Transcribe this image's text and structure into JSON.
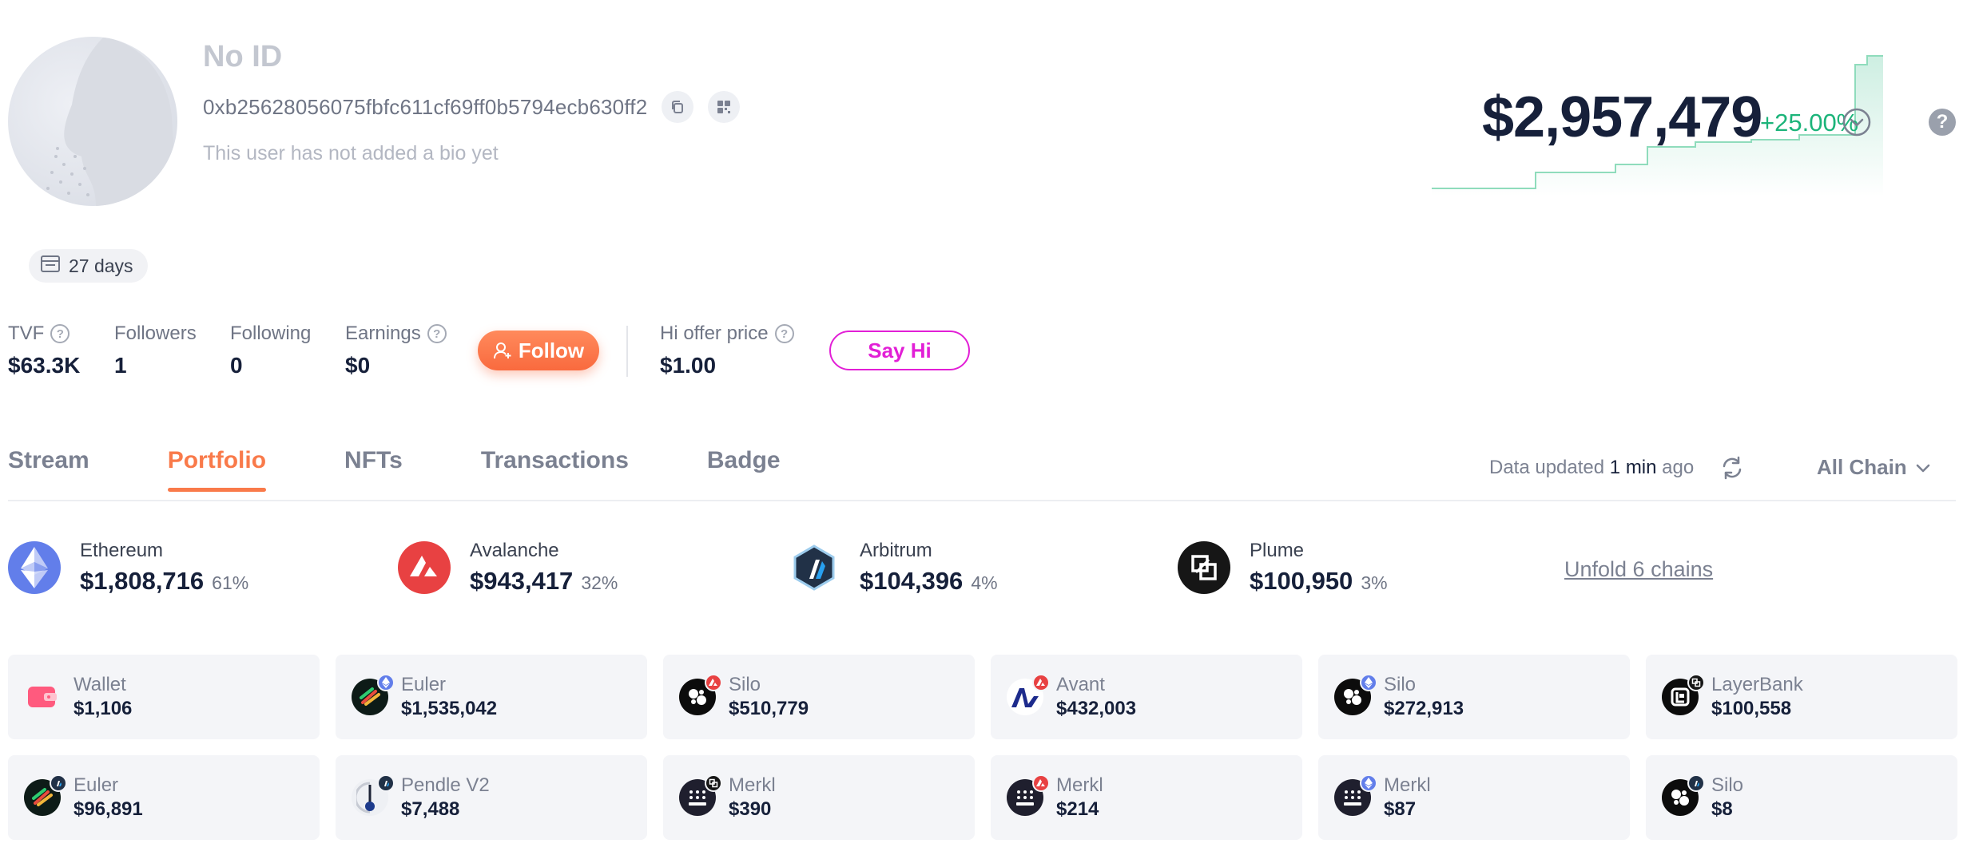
{
  "profile": {
    "name": "No ID",
    "address": "0xb25628056075fbfc611cf69ff0b5794ecb630ff2",
    "bio": "This user has not added a bio yet",
    "age_badge": "27 days"
  },
  "balance": {
    "value": "$2,957,479",
    "change": "+25.00%",
    "change_color": "#1cb47a"
  },
  "stats": {
    "tvf": {
      "label": "TVF",
      "value": "$63.3K"
    },
    "followers": {
      "label": "Followers",
      "value": "1"
    },
    "following": {
      "label": "Following",
      "value": "0"
    },
    "earnings": {
      "label": "Earnings",
      "value": "$0"
    },
    "follow_button": "Follow",
    "hi_offer": {
      "label": "Hi offer price",
      "value": "$1.00"
    },
    "say_hi_button": "Say Hi"
  },
  "tabs": [
    {
      "label": "Stream",
      "active": false
    },
    {
      "label": "Portfolio",
      "active": true
    },
    {
      "label": "NFTs",
      "active": false
    },
    {
      "label": "Transactions",
      "active": false
    },
    {
      "label": "Badge",
      "active": false
    }
  ],
  "toolbar": {
    "updated_prefix": "Data updated ",
    "updated_time": "1 min",
    "updated_suffix": " ago",
    "chain_filter": "All Chain"
  },
  "chains": [
    {
      "name": "Ethereum",
      "value": "$1,808,716",
      "pct": "61%",
      "icon": "ethereum-icon"
    },
    {
      "name": "Avalanche",
      "value": "$943,417",
      "pct": "32%",
      "icon": "avalanche-icon"
    },
    {
      "name": "Arbitrum",
      "value": "$104,396",
      "pct": "4%",
      "icon": "arbitrum-icon"
    },
    {
      "name": "Plume",
      "value": "$100,950",
      "pct": "3%",
      "icon": "plume-icon"
    }
  ],
  "unfold_label": "Unfold 6 chains",
  "protocols": [
    {
      "name": "Wallet",
      "value": "$1,106",
      "icon": "wallet-icon",
      "chain": ""
    },
    {
      "name": "Euler",
      "value": "$1,535,042",
      "icon": "euler-icon",
      "chain": "ethereum"
    },
    {
      "name": "Silo",
      "value": "$510,779",
      "icon": "silo-icon",
      "chain": "avalanche"
    },
    {
      "name": "Avant",
      "value": "$432,003",
      "icon": "avant-icon",
      "chain": "avalanche"
    },
    {
      "name": "Silo",
      "value": "$272,913",
      "icon": "silo-icon",
      "chain": "ethereum"
    },
    {
      "name": "LayerBank",
      "value": "$100,558",
      "icon": "layerbank-icon",
      "chain": "plume"
    },
    {
      "name": "Euler",
      "value": "$96,891",
      "icon": "euler-icon",
      "chain": "arbitrum"
    },
    {
      "name": "Pendle V2",
      "value": "$7,488",
      "icon": "pendle-icon",
      "chain": "arbitrum"
    },
    {
      "name": "Merkl",
      "value": "$390",
      "icon": "merkl-icon",
      "chain": "plume"
    },
    {
      "name": "Merkl",
      "value": "$214",
      "icon": "merkl-icon",
      "chain": "avalanche"
    },
    {
      "name": "Merkl",
      "value": "$87",
      "icon": "merkl-icon",
      "chain": "ethereum"
    },
    {
      "name": "Silo",
      "value": "$8",
      "icon": "silo-icon",
      "chain": "arbitrum"
    }
  ]
}
